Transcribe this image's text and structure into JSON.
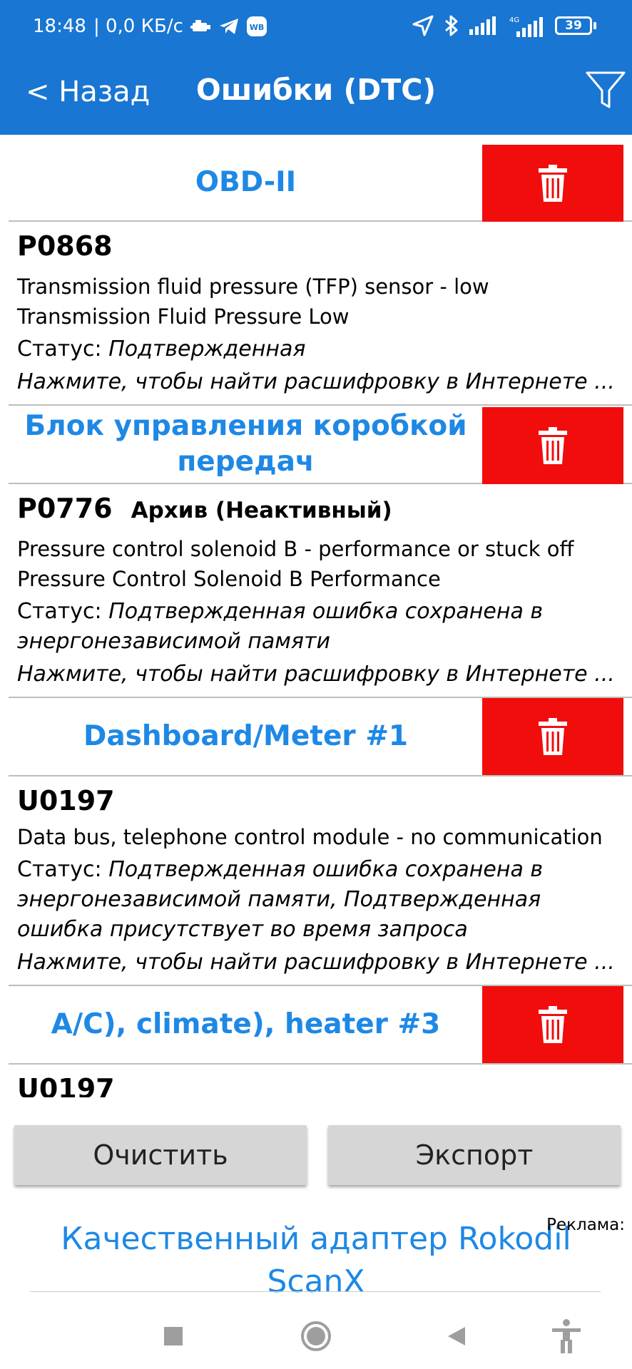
{
  "statusbar": {
    "time": "18:48",
    "speed": "| 0,0 КБ/с",
    "wb_label": "WB",
    "net_label": "4G",
    "battery": "39"
  },
  "appbar": {
    "back_label": "< Назад",
    "title": "Ошибки (DTC)"
  },
  "sections": [
    {
      "title": "OBD-II",
      "entries": [
        {
          "code": "P0868",
          "archive": "",
          "desc": [
            "Transmission fluid pressure (TFP) sensor - low",
            "Transmission Fluid Pressure Low"
          ],
          "status_label": "Статус: ",
          "status_value": "Подтвержденная",
          "lookup": "Нажмите, чтобы найти расшифровку в Интернете ..."
        }
      ]
    },
    {
      "title": "Блок управления коробкой передач",
      "entries": [
        {
          "code": "P0776",
          "archive": "Архив (Неактивный)",
          "desc": [
            "Pressure control solenoid B - performance or stuck off",
            "Pressure Control Solenoid B Performance"
          ],
          "status_label": "Статус: ",
          "status_value": "Подтвержденная ошибка сохранена в энергонезависимой памяти",
          "lookup": "Нажмите, чтобы найти расшифровку в Интернете ..."
        }
      ]
    },
    {
      "title": "Dashboard/Meter #1",
      "entries": [
        {
          "code": "U0197",
          "archive": "",
          "desc": [
            "Data bus, telephone control module - no communication"
          ],
          "status_label": "Статус: ",
          "status_value": "Подтвержденная ошибка сохранена в энергонезависимой памяти, Подтвержденная ошибка присутствует во время запроса",
          "lookup": "Нажмите, чтобы найти расшифровку в Интернете ..."
        }
      ]
    },
    {
      "title": "A/C), climate), heater #3",
      "entries": [
        {
          "code": "U0197",
          "archive": "",
          "desc": [],
          "status_label": "",
          "status_value": "",
          "lookup": ""
        }
      ]
    }
  ],
  "buttons": {
    "clear": "Очистить",
    "export": "Экспорт"
  },
  "ad": {
    "label": "Реклама:",
    "text": "Качественный адаптер Rokodil ScanX"
  },
  "icons": {
    "delete": "trash-icon",
    "filter": "filter-icon"
  },
  "colors": {
    "header_bg": "#1976D2",
    "accent_text": "#1E88E5",
    "delete_bg": "#F20D0D",
    "button_bg": "#D6D6D6"
  }
}
